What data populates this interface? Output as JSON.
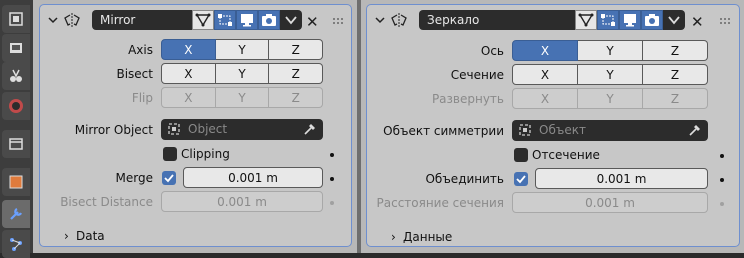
{
  "left": {
    "name": "Mirror",
    "axis": {
      "label": "Axis",
      "buttons": [
        "X",
        "Y",
        "Z"
      ]
    },
    "bisect": {
      "label": "Bisect",
      "buttons": [
        "X",
        "Y",
        "Z"
      ]
    },
    "flip": {
      "label": "Flip",
      "buttons": [
        "X",
        "Y",
        "Z"
      ]
    },
    "mirror_object": {
      "label": "Mirror Object",
      "placeholder": "Object"
    },
    "clipping": "Clipping",
    "merge": {
      "label": "Merge",
      "value": "0.001 m"
    },
    "bisect_distance": {
      "label": "Bisect Distance",
      "value": "0.001 m"
    },
    "data": "Data"
  },
  "right": {
    "name": "Зеркало",
    "axis": {
      "label": "Ось",
      "buttons": [
        "X",
        "Y",
        "Z"
      ]
    },
    "bisect": {
      "label": "Сечение",
      "buttons": [
        "X",
        "Y",
        "Z"
      ]
    },
    "flip": {
      "label": "Развернуть",
      "buttons": [
        "X",
        "Y",
        "Z"
      ]
    },
    "mirror_object": {
      "label": "Объект симметрии",
      "placeholder": "Объект"
    },
    "clipping": "Отсечение",
    "merge": {
      "label": "Объединить",
      "value": "0.001 m"
    },
    "bisect_distance": {
      "label": "Расстояние сечения",
      "value": "0.001 m"
    },
    "data": "Данные"
  },
  "colors": {
    "accent": "#4772b3",
    "panel": "#c7c7c7",
    "field_dark": "#2c2c2c"
  },
  "icons": [
    "tool-icon",
    "render-icon",
    "output-icon",
    "world-icon",
    "collection-icon",
    "object-icon",
    "modifier-wrench-icon",
    "particles-icon"
  ]
}
